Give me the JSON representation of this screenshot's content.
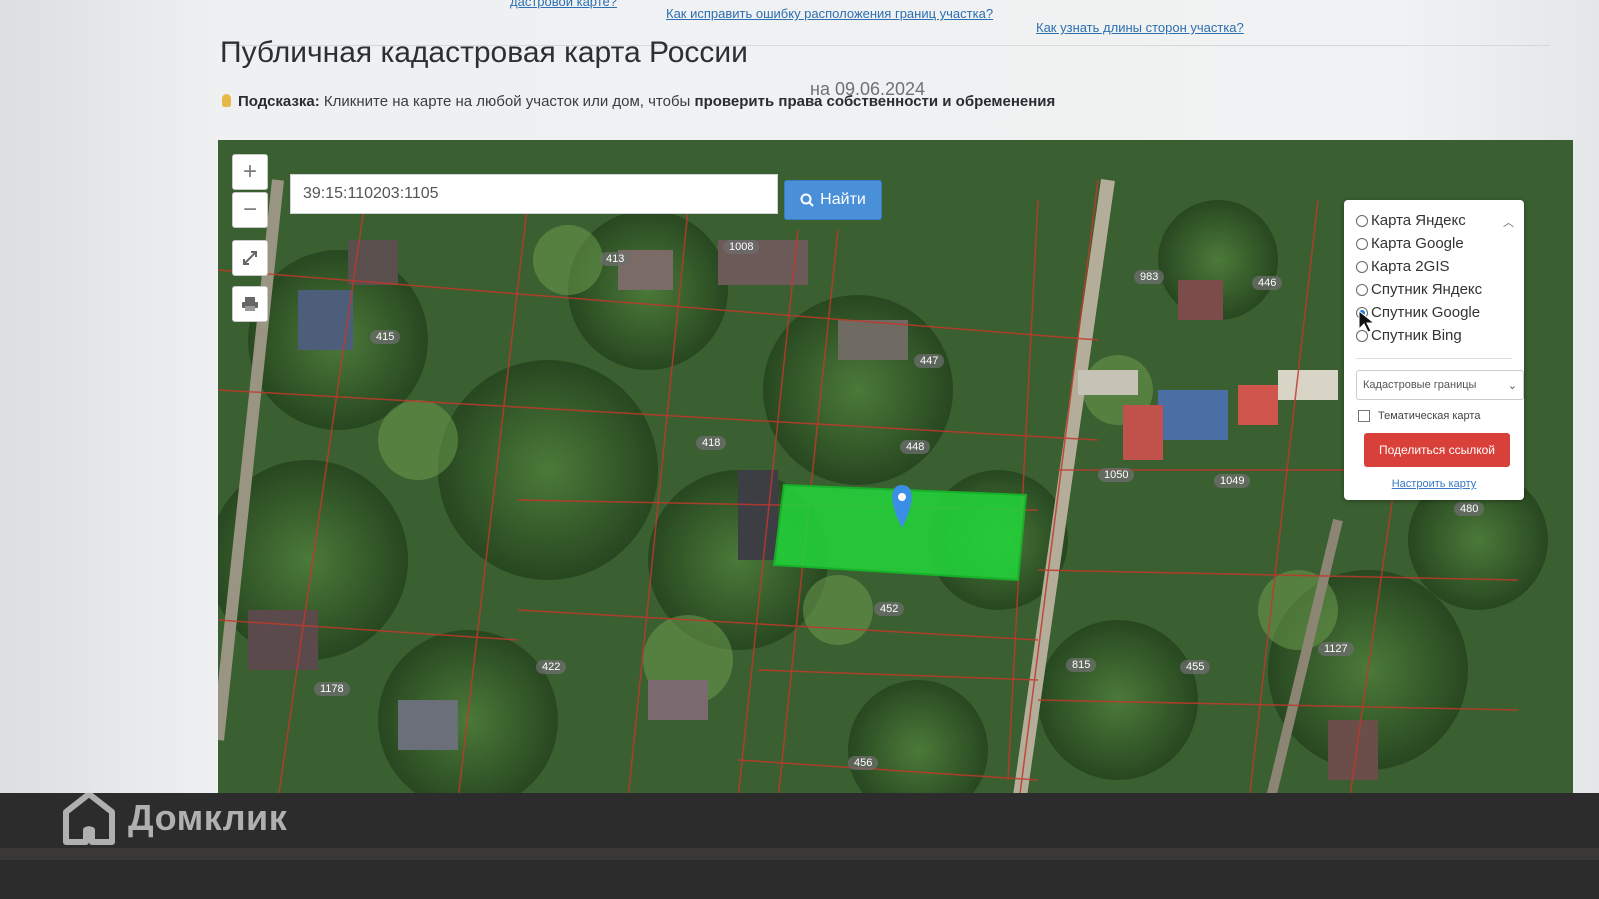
{
  "header": {
    "links": [
      "дастровой карте?",
      "Как исправить ошибку расположения границ участка?",
      "Как узнать длины сторон участка?"
    ],
    "title": "Публичная кадастровая карта России",
    "date": "на 09.06.2024",
    "hint_label": "Подсказка:",
    "hint_text": "Кликните на карте на любой участок или дом, чтобы",
    "hint_bold": "проверить права собственности и обременения"
  },
  "search": {
    "value": "39:15:110203:1105",
    "button_label": "Найти"
  },
  "map_controls": {
    "zoom_in": "+",
    "zoom_out": "−"
  },
  "layers_panel": {
    "options": [
      {
        "label": "Карта Яндекс",
        "selected": false
      },
      {
        "label": "Карта Google",
        "selected": false
      },
      {
        "label": "Карта 2GIS",
        "selected": false
      },
      {
        "label": "Спутник Яндекс",
        "selected": false
      },
      {
        "label": "Спутник Google",
        "selected": true
      },
      {
        "label": "Спутник Bing",
        "selected": false
      }
    ],
    "select_value": "Кадастровые границы",
    "checkbox_label": "Тематическая карта",
    "share_label": "Поделиться ссылкой",
    "settings_link": "Настроить карту"
  },
  "lot_labels": [
    "1008",
    "413",
    "415",
    "447",
    "448",
    "418",
    "452",
    "422",
    "1178",
    "456",
    "983",
    "446",
    "1050",
    "1049",
    "815",
    "455",
    "1127",
    "480"
  ],
  "colors": {
    "selected_parcel": "#22d33a",
    "boundary": "#c0392b",
    "accent": "#4a90d9",
    "share": "#d9403a"
  },
  "watermark": {
    "brand": "Домклик"
  }
}
